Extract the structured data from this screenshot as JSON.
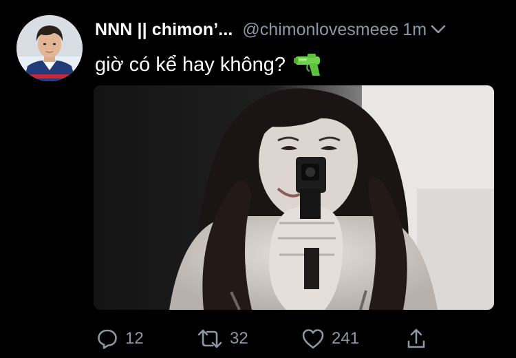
{
  "tweet": {
    "display_name": "NNN || chimon’...",
    "handle": "@chimonlovesmeee",
    "timestamp": "1m",
    "text": "giờ có kể hay không?",
    "emoji": "water-pistol-emoji"
  },
  "actions": {
    "reply_count": "12",
    "retweet_count": "32",
    "like_count": "241"
  },
  "icons": {
    "reply": "speech-bubble-icon",
    "retweet": "retweet-arrows-icon",
    "like": "heart-icon",
    "share": "share-upload-icon",
    "more": "chevron-down-icon"
  },
  "colors": {
    "background": "#000000",
    "text_primary": "#ffffff",
    "text_secondary": "#8b98a5",
    "emoji_green": "#6fd24a"
  }
}
